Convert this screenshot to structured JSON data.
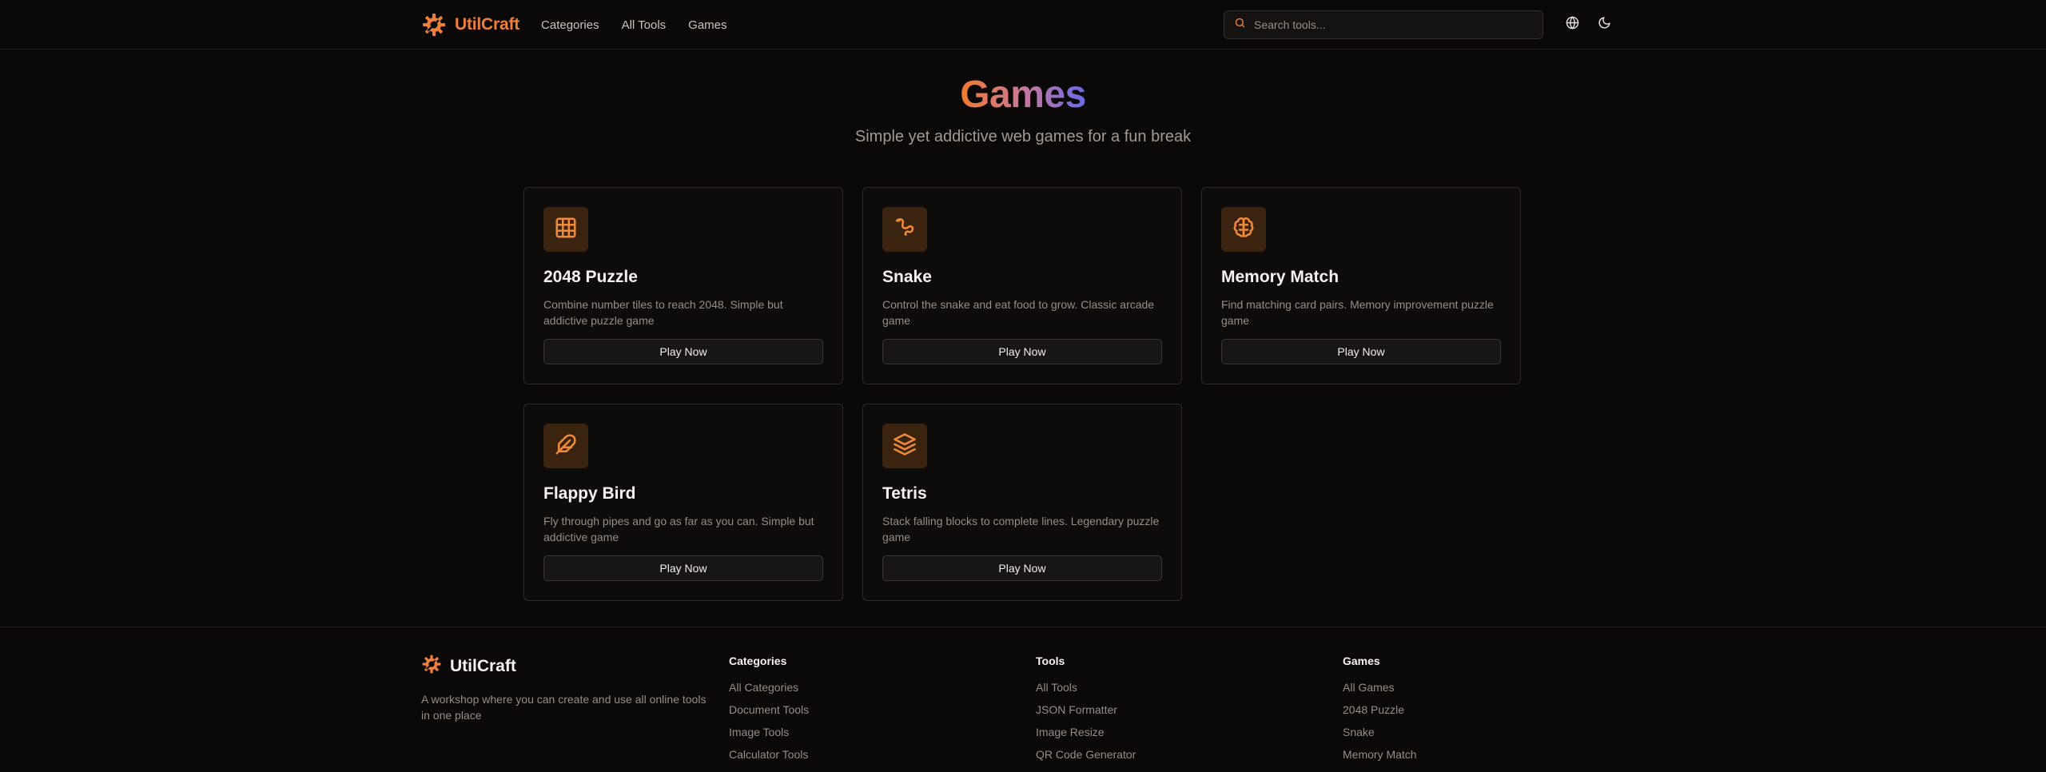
{
  "brand": {
    "name": "UtilCraft",
    "accent": "#ee7f3d"
  },
  "nav": [
    {
      "label": "Categories"
    },
    {
      "label": "All Tools"
    },
    {
      "label": "Games"
    }
  ],
  "search": {
    "placeholder": "Search tools..."
  },
  "header_icons": {
    "language": "globe-icon",
    "theme": "moon-icon"
  },
  "hero": {
    "title": "Games",
    "subtitle": "Simple yet addictive web games for a fun break"
  },
  "games": [
    {
      "icon": "grid-icon",
      "title": "2048 Puzzle",
      "description": "Combine number tiles to reach 2048. Simple but addictive puzzle game",
      "button": "Play Now"
    },
    {
      "icon": "snake-icon",
      "title": "Snake",
      "description": "Control the snake and eat food to grow. Classic arcade game",
      "button": "Play Now"
    },
    {
      "icon": "brain-icon",
      "title": "Memory Match",
      "description": "Find matching card pairs. Memory improvement puzzle game",
      "button": "Play Now"
    },
    {
      "icon": "feather-icon",
      "title": "Flappy Bird",
      "description": "Fly through pipes and go as far as you can. Simple but addictive game",
      "button": "Play Now"
    },
    {
      "icon": "layers-icon",
      "title": "Tetris",
      "description": "Stack falling blocks to complete lines. Legendary puzzle game",
      "button": "Play Now"
    }
  ],
  "footer": {
    "brand": "UtilCraft",
    "description": "A workshop where you can create and use all online tools in one place",
    "columns": [
      {
        "title": "Categories",
        "links": [
          "All Categories",
          "Document Tools",
          "Image Tools",
          "Calculator Tools"
        ]
      },
      {
        "title": "Tools",
        "links": [
          "All Tools",
          "JSON Formatter",
          "Image Resize",
          "QR Code Generator"
        ]
      },
      {
        "title": "Games",
        "links": [
          "All Games",
          "2048 Puzzle",
          "Snake",
          "Memory Match"
        ]
      }
    ]
  }
}
